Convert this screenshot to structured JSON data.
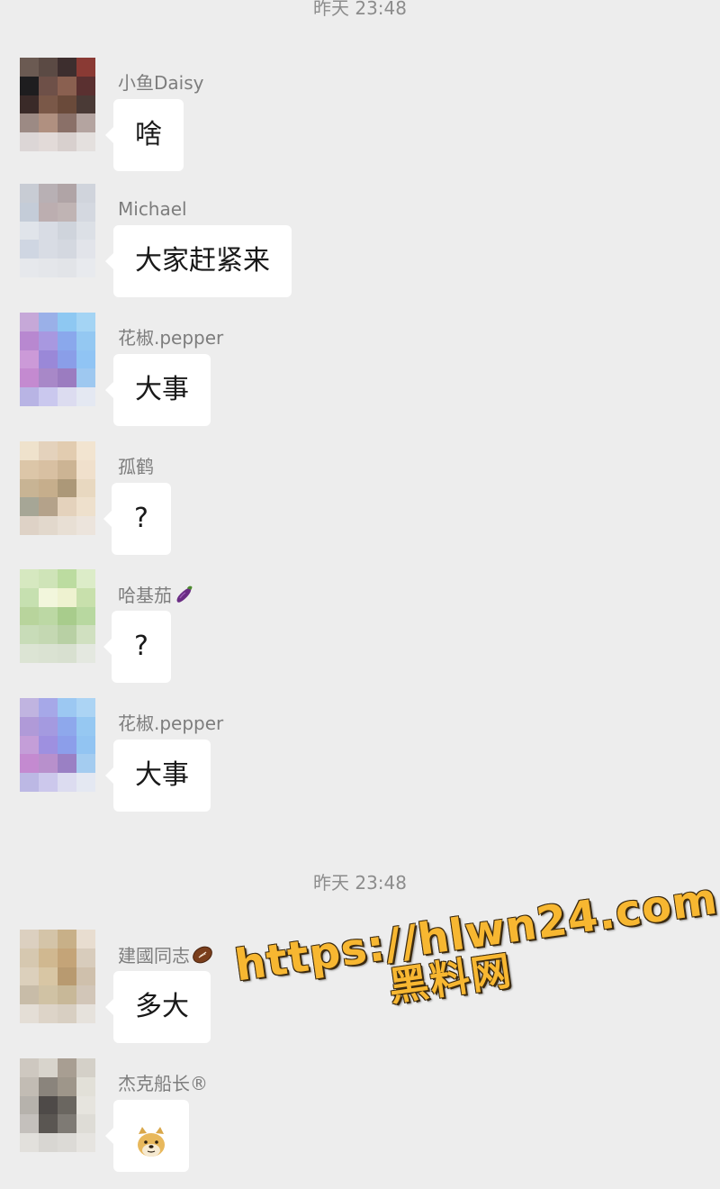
{
  "chat": {
    "timestamps": [
      "昨天 23:48",
      "昨天 23:48"
    ],
    "messages": [
      {
        "sender": "小鱼Daisy",
        "text": "啥"
      },
      {
        "sender": "Michael",
        "text": "大家赶紧来"
      },
      {
        "sender": "花椒.pepper",
        "text": "大事"
      },
      {
        "sender": "孤鹤",
        "text": "?"
      },
      {
        "sender": "哈基茄",
        "sender_emoji": "eggplant-emoji",
        "text": "?"
      },
      {
        "sender": "花椒.pepper",
        "text": "大事"
      },
      {
        "sender": "建國同志",
        "sender_emoji": "rugby-ball-emoji",
        "text": "多大"
      },
      {
        "sender": "杰克船长®",
        "text": "",
        "bubble_icon": "doge-emoji"
      }
    ]
  },
  "watermark": {
    "url": "https://hlwn24.com",
    "site": "黑料网",
    "color": "#f7b731"
  },
  "colors": {
    "background": "#ededed",
    "bubble": "#ffffff",
    "sender_text": "#7d7d7d",
    "message_text": "#191919",
    "timestamp_text": "#8c8c8c"
  },
  "avatars": [
    {
      "palette": [
        "#6b5a52",
        "#5b4a44",
        "#3d2e2e",
        "#8a3a34",
        "#1e1d1f",
        "#6e5048",
        "#8a6050",
        "#5a3030",
        "#3a2a28",
        "#7a5848",
        "#6a4a3a",
        "#4a3a36",
        "#9c8a84",
        "#b09080",
        "#8a7068",
        "#b4a4a0",
        "#dcd6d6",
        "#e2dad8",
        "#d8d0ce",
        "#e4e0de"
      ]
    },
    {
      "palette": [
        "#c8ccd4",
        "#b8b0b4",
        "#b0a4a6",
        "#d0d4dc",
        "#c4ccd8",
        "#bcaeb0",
        "#c0b4b4",
        "#d4d8e0",
        "#e0e4ea",
        "#d8dce4",
        "#cfd4dc",
        "#dce0e6",
        "#cfd6e2",
        "#d8dce4",
        "#d4d8e0",
        "#e2e4ea",
        "#e6e8ec",
        "#e4e6ea",
        "#e2e4e8",
        "#e8eaee"
      ]
    },
    {
      "palette": [
        "#c6a8d8",
        "#9ab0e8",
        "#8ec8f2",
        "#a4d4f4",
        "#b888d0",
        "#a898e0",
        "#8aa8ec",
        "#94c8f2",
        "#cc9ad8",
        "#9a88d8",
        "#8a9ee8",
        "#90c4f4",
        "#c48ad0",
        "#a888c8",
        "#9b7cc0",
        "#9ec8f0",
        "#b8b4e4",
        "#cac8ee",
        "#dcdcf0",
        "#e4e8f2"
      ]
    },
    {
      "palette": [
        "#efe2cc",
        "#e4d2bc",
        "#e2ccb0",
        "#f2e4d0",
        "#dcc6a8",
        "#d8c0a2",
        "#ccb494",
        "#f0e0cc",
        "#c8b494",
        "#c6ae8c",
        "#ac9878",
        "#e8d8c0",
        "#a6a696",
        "#b4a28a",
        "#e4d2bc",
        "#eee0cc",
        "#ded2c6",
        "#e2d8cc",
        "#e8dfd4",
        "#ece4dc"
      ]
    },
    {
      "palette": [
        "#d6e8c0",
        "#cfe4b8",
        "#bcdca0",
        "#dcecc8",
        "#c6e0b0",
        "#f2f6dc",
        "#eef2d0",
        "#c8e0ac",
        "#b8d49c",
        "#bcd8a4",
        "#a8cc8c",
        "#b8d8a0",
        "#c8dcb8",
        "#c4d8b2",
        "#b8d0a4",
        "#d0e0c0",
        "#dce4d4",
        "#dae2d2",
        "#d8e0d0",
        "#e4e8e0"
      ]
    },
    {
      "palette": [
        "#c0b4e0",
        "#a6a8e8",
        "#9cc8f2",
        "#acd4f4",
        "#b09ad8",
        "#a49ae0",
        "#8ea8ec",
        "#96c8f2",
        "#c49ed8",
        "#9e90e0",
        "#8c9eea",
        "#92c4f2",
        "#c48ad0",
        "#b890cc",
        "#9a80c4",
        "#a4ccf0",
        "#bcb8e4",
        "#ccc8ec",
        "#dcdcf0",
        "#e4e8f2"
      ]
    },
    {
      "palette": [
        "#dcd0c0",
        "#d4c4a8",
        "#c8b088",
        "#e8ddd0",
        "#d6c8b0",
        "#d0b890",
        "#c4a478",
        "#d8ccbc",
        "#dcd0bc",
        "#d8c6a4",
        "#b89a70",
        "#cfc0ac",
        "#c8bca8",
        "#d0c2a4",
        "#c8b898",
        "#d2c6b8",
        "#e4ded6",
        "#ddd4c8",
        "#d8cfc2",
        "#e6e2dc"
      ]
    },
    {
      "palette": [
        "#cec8c0",
        "#d8d4cc",
        "#a89e92",
        "#d4d0c8",
        "#c2bcb4",
        "#8a847c",
        "#9e968a",
        "#e2e0d8",
        "#b6b2ac",
        "#4e4a48",
        "#6a6660",
        "#e6e4de",
        "#c4c0bc",
        "#5a5652",
        "#7e7a74",
        "#dedcd6",
        "#e2e0dc",
        "#d8d6d2",
        "#dcdad6",
        "#e6e4e0"
      ]
    }
  ]
}
